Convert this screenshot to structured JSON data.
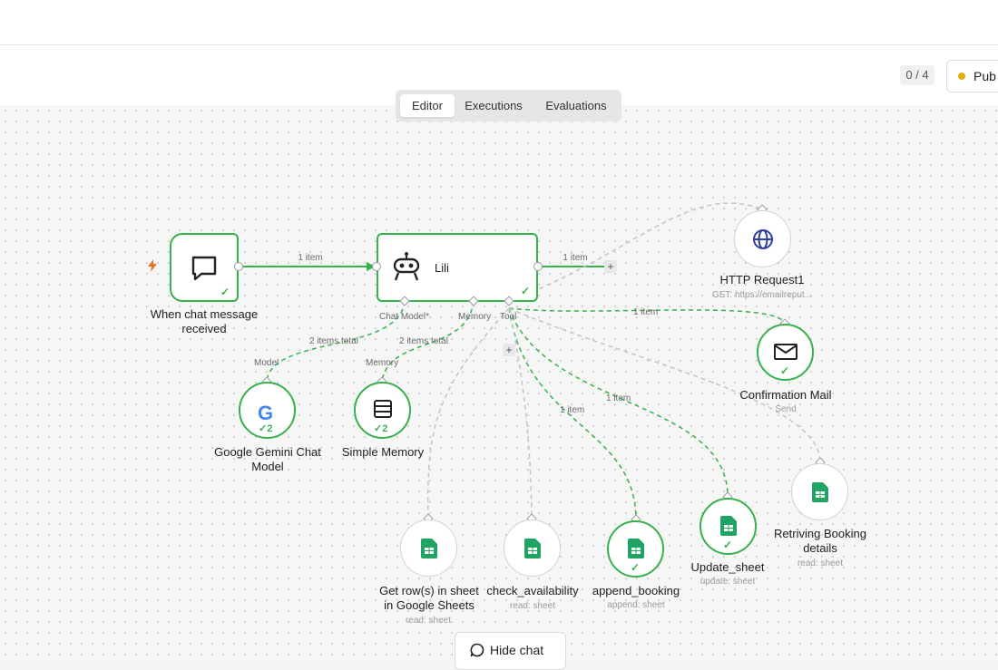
{
  "header": {
    "counter": "0 / 4",
    "publish_label": "Pub",
    "publish_status_color": "#e1b106"
  },
  "tabs": [
    {
      "label": "Editor",
      "active": true
    },
    {
      "label": "Executions",
      "active": false
    },
    {
      "label": "Evaluations",
      "active": false
    }
  ],
  "nodes": {
    "trigger": {
      "title": "When chat message received",
      "icon": "chat-bubble-icon",
      "trigger_icon": "lightning-icon"
    },
    "agent": {
      "title": "Lili",
      "icon": "robot-icon",
      "ports": [
        "Chat Model*",
        "Memory",
        "Tool"
      ]
    },
    "http": {
      "title": "HTTP Request1",
      "subtitle": "GET: https://emailreput...",
      "icon": "globe-icon"
    },
    "gemini": {
      "title": "Google Gemini Chat Model",
      "port_label": "Model",
      "count": "2",
      "icon": "google-icon"
    },
    "memory": {
      "title": "Simple Memory",
      "port_label": "Memory",
      "count": "2",
      "icon": "database-icon"
    },
    "mail": {
      "title": "Confirmation Mail",
      "subtitle": "Send",
      "icon": "envelope-icon"
    },
    "get_rows": {
      "title": "Get row(s) in sheet in Google Sheets",
      "subtitle": "read: sheet",
      "icon": "sheets-icon"
    },
    "check_availability": {
      "title": "check_availability",
      "subtitle": "read: sheet",
      "icon": "sheets-icon"
    },
    "append_booking": {
      "title": "append_booking",
      "subtitle": "append: sheet",
      "icon": "sheets-icon"
    },
    "update_sheet": {
      "title": "Update_sheet",
      "subtitle": "update: sheet",
      "icon": "sheets-icon"
    },
    "retrieving": {
      "title": "Retriving Booking details",
      "subtitle": "read: sheet",
      "icon": "sheets-icon"
    }
  },
  "edge_labels": {
    "trigger_agent": "1 item",
    "agent_out": "1 item",
    "model": "2 items total",
    "memory": "2 items total",
    "mail": "1 item",
    "update": "1 item",
    "append": "1 item"
  },
  "hide_chat": "Hide chat",
  "colors": {
    "success": "#35b24a",
    "edge_pending": "#c4c4c8"
  }
}
